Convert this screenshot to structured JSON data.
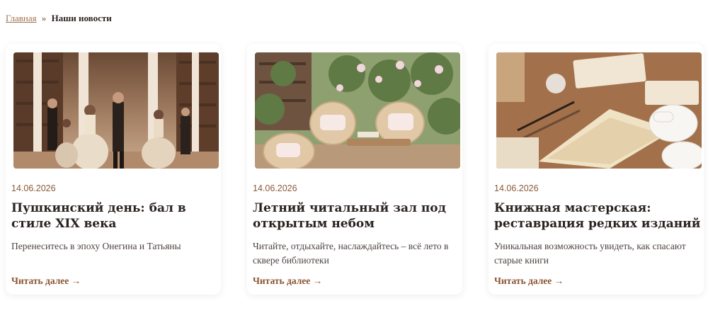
{
  "breadcrumb": {
    "home": "Главная",
    "separator": "»",
    "current": "Наши новости"
  },
  "articles": [
    {
      "date": "14.06.2026",
      "title": "Пушкинский день: бал в стиле XIX века",
      "excerpt": "Перенеситесь в эпоху Онегина и Татьяны",
      "read_more": "Читать далее →",
      "image": "ballroom-dance-photo"
    },
    {
      "date": "14.06.2026",
      "title": "Летний читальный зал под открытым небом",
      "excerpt": "Читайте, отдыхайте, наслаждайтесь – всё лето в сквере библиотеки",
      "read_more": "Читать далее →",
      "image": "garden-reading-room-photo"
    },
    {
      "date": "14.06.2026",
      "title": "Книжная мастерская: реставрация редких изданий",
      "excerpt": "Уникальная возможность увидеть, как спасают старые книги",
      "read_more": "Читать далее →",
      "image": "book-restoration-photo"
    }
  ],
  "colors": {
    "accent": "#8a5330",
    "link": "#a0714f",
    "date": "#8a5a3a",
    "title": "#2b2320"
  }
}
